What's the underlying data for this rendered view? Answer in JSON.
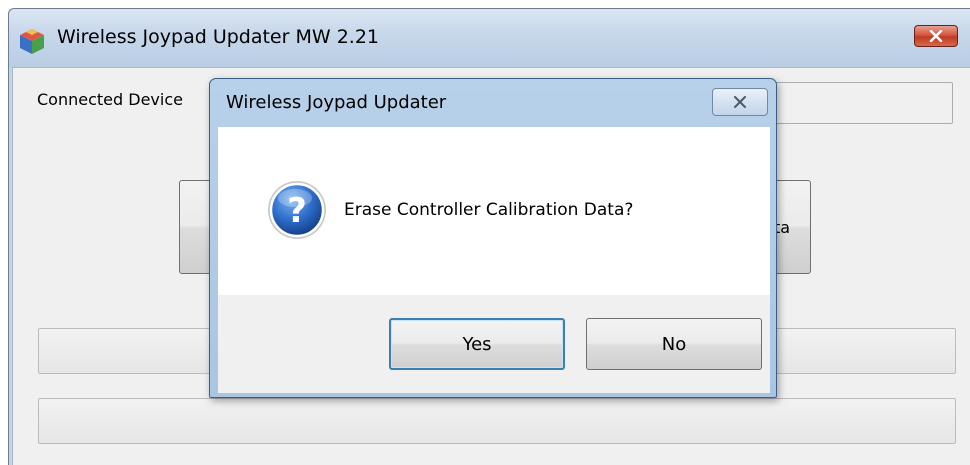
{
  "main_window": {
    "title": "Wireless Joypad Updater MW 2.21",
    "app_icon": "app-cube-icon",
    "close_icon": "close-icon",
    "connected_label": "Connected Device",
    "right_button_partial_text": "ta"
  },
  "dialog": {
    "title": "Wireless Joypad Updater",
    "close_icon": "close-icon",
    "icon": "question-icon",
    "message": "Erase Controller Calibration Data?",
    "yes_label": "Yes",
    "no_label": "No"
  },
  "colors": {
    "title_bar": "#c6d7ea",
    "close_red": "#c13a20",
    "question_blue": "#1f5fb8",
    "default_button_border": "#3c7fb1"
  }
}
